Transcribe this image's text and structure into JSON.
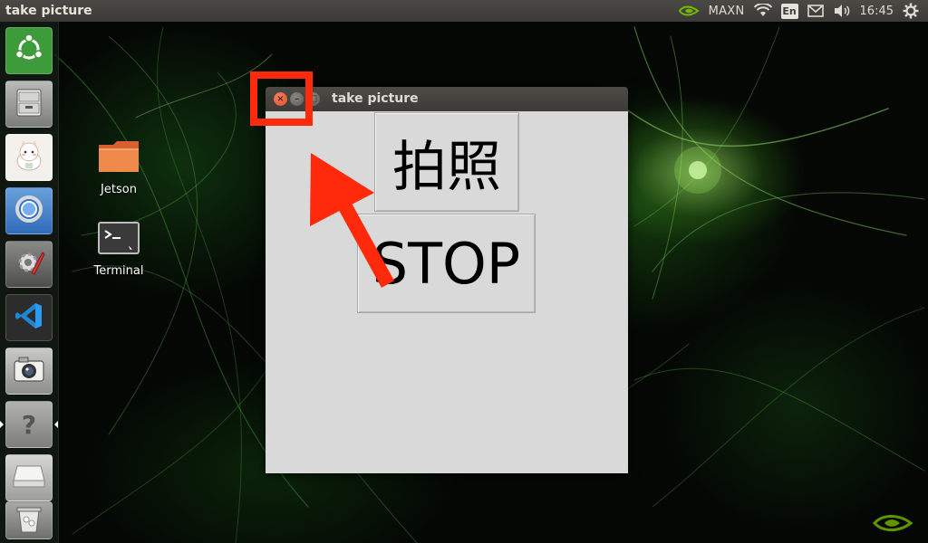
{
  "topPanel": {
    "appTitle": "take picture",
    "indicators": {
      "nvidiaIcon": "nvidia-logo-icon",
      "powerMode": "MAXN",
      "wifiIcon": "wifi-icon",
      "language": "En",
      "mailIcon": "mail-icon",
      "volumeIcon": "volume-icon",
      "time": "16:45",
      "settingsIcon": "gear-icon"
    }
  },
  "launcher": {
    "items": [
      {
        "icon": "ubuntu-logo-icon",
        "color": "#3e9b3c"
      },
      {
        "icon": "file-cabinet-icon",
        "color": "#9a9a98"
      },
      {
        "icon": "cat-app-icon",
        "color": "#f4f1ec"
      },
      {
        "icon": "chromium-icon",
        "color": "#4a8fd8"
      },
      {
        "icon": "settings-tools-icon",
        "color": "#6a6a6a"
      },
      {
        "icon": "vscode-icon",
        "color": "#1f86d4"
      },
      {
        "icon": "camera-icon",
        "color": "#b8b8b4"
      },
      {
        "icon": "help-icon",
        "color": "#9e9e9c"
      },
      {
        "icon": "drive-icon",
        "color": "#c9c9c6"
      },
      {
        "icon": "trash-icon",
        "color": "#8d8d8b"
      }
    ]
  },
  "desktop": {
    "icons": [
      {
        "label": "Jetson",
        "icon": "folder-icon"
      },
      {
        "label": "Terminal",
        "icon": "terminal-icon"
      }
    ]
  },
  "window": {
    "title": "take picture",
    "controls": {
      "close": "×",
      "minimize": "–",
      "maximize": "□"
    },
    "buttons": {
      "photo": "拍照",
      "stop": "STOP"
    }
  },
  "annotation": {
    "color": "#ff2a0c"
  }
}
